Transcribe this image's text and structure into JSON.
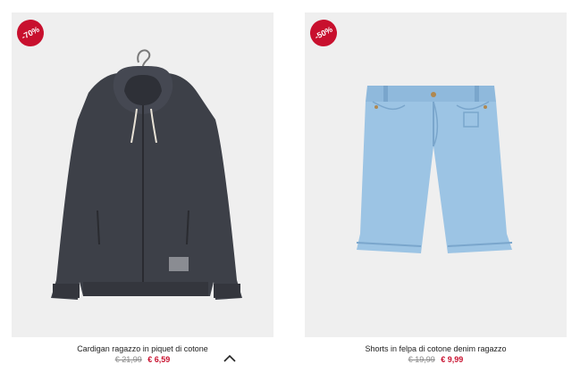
{
  "products": [
    {
      "badge": "-70%",
      "title": "Cardigan ragazzo in piquet di cotone",
      "old_price": "€ 21,99",
      "new_price": "€ 6,59",
      "image": "hoodie-image"
    },
    {
      "badge": "-50%",
      "title": "Shorts in felpa di cotone denim ragazzo",
      "old_price": "€ 19,99",
      "new_price": "€ 9,99",
      "image": "denim-shorts-image"
    }
  ],
  "colors": {
    "badge": "#c8102e",
    "sale_price": "#c8102e",
    "image_bg": "#efefef"
  },
  "icons": {
    "scroll_up": "chevron-up-icon"
  }
}
